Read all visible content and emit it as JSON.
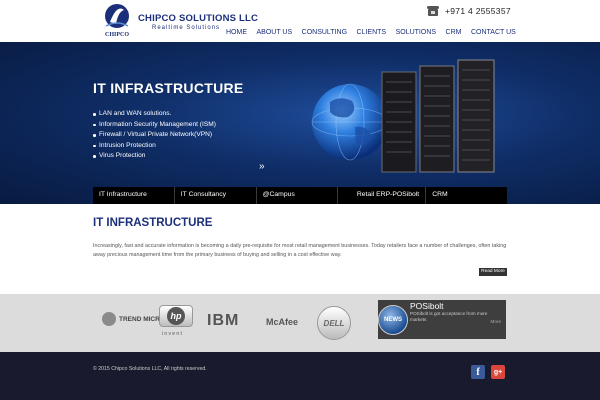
{
  "header": {
    "brand": "CHIPCO SOLUTIONS LLC",
    "tagline": "Realtime Solutions",
    "logo_text": "CHIPCO",
    "phone": "+971 4 2555357",
    "phone_icon": "phone-icon"
  },
  "nav": {
    "items": [
      "HOME",
      "ABOUT US",
      "CONSULTING",
      "CLIENTS",
      "SOLUTIONS",
      "CRM",
      "CONTACT US"
    ]
  },
  "banner": {
    "title": "IT INFRASTRUCTURE",
    "bullets": [
      "LAN and WAN solutions.",
      "Information Security Management (ISM)",
      "Firewall / Virtual Private Network(VPN)",
      "Intrusion Protection",
      "Virus Protection"
    ],
    "next_arrow": "»",
    "tabs": [
      "IT Infrastructure",
      "IT Consultancy",
      "@Campus",
      "Retail ERP-POSibolt",
      "CRM"
    ]
  },
  "content": {
    "title": "IT INFRASTRUCTURE",
    "text": "Increasingly, fast and accurate information is becoming a daily pre-requisite for most retail management businesses. Today retailers face a number of challenges, often taking away precious management time from the primary business of buying and selling in a cost effective way.",
    "read_more": "Read More"
  },
  "partners": {
    "trend": "TREND MICRO",
    "hp": "hp",
    "hp_sub": "invent",
    "ibm": "IBM",
    "mcafee": "McAfee",
    "dell": "DELL"
  },
  "news": {
    "icon_label": "NEWS",
    "title": "POSibolt",
    "text": "POSibolt is got acceptance from more markets",
    "more": "More"
  },
  "footer": {
    "copyright": "© 2015 Chipco Solutions LLC, All rights reserved.",
    "facebook": "f",
    "googleplus": "g+"
  },
  "colors": {
    "brand_blue": "#1c2f7a",
    "banner_dark": "#081a40",
    "footer_bg": "#1a1a2e"
  }
}
